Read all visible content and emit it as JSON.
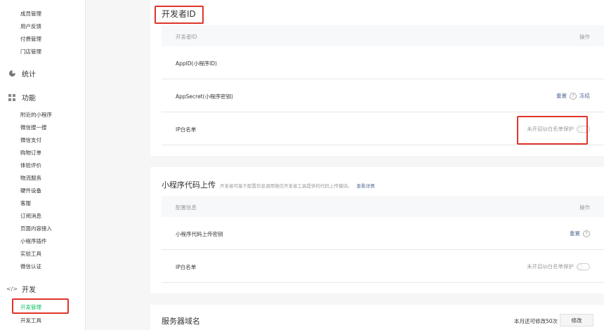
{
  "sidebar": {
    "top_items": [
      "成员管理",
      "用户反馈",
      "付费管理",
      "门店管理"
    ],
    "stats_label": "统计",
    "features_label": "功能",
    "feature_items": [
      "附近的小程序",
      "微信搜一搜",
      "微信支付",
      "购物订单",
      "体验评价",
      "物流服务",
      "硬件设备",
      "客服",
      "订阅消息",
      "页面内容接入",
      "小程序插件",
      "实验工具",
      "微信认证"
    ],
    "dev_label": "开发",
    "dev_items": [
      "开发管理",
      "开发工具"
    ]
  },
  "dev_id_card": {
    "title": "开发者ID",
    "header_left": "开发者ID",
    "header_right": "操作",
    "appid_label": "AppID(小程序ID)",
    "secret_label": "AppSecret(小程序密钥)",
    "reset_label": "重置",
    "freeze_label": "冻结",
    "ip_label": "IP白名单",
    "ip_status": "未开启ip白名单保护"
  },
  "upload_card": {
    "title": "小程序代码上传",
    "desc": "开发者可基于配置信息调用微信开发者工具提供的代码上传模块。",
    "detail_link": "查看详情",
    "header_left": "配置信息",
    "header_right": "操作",
    "key_label": "小程序代码上传密钥",
    "reset_label": "重置",
    "ip_label": "IP白名单",
    "ip_status": "未开启ip白名单保护"
  },
  "server_card": {
    "title": "服务器域名",
    "remaining": "本月还可修改50次",
    "modify_button": "修改"
  },
  "colors": {
    "accent": "#07c160",
    "link": "#576b95",
    "highlight": "#e0352b"
  }
}
